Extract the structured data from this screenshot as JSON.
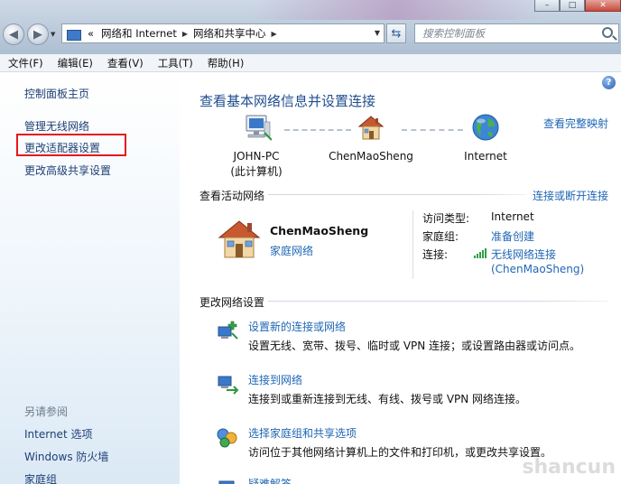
{
  "address": {
    "prefix": "«",
    "crumbs": [
      "网络和 Internet",
      "网络和共享中心"
    ]
  },
  "search": {
    "placeholder": "搜索控制面板"
  },
  "window_buttons": {
    "minimize": "–",
    "maximize": "□",
    "close": "✕"
  },
  "menu": [
    "文件(F)",
    "编辑(E)",
    "查看(V)",
    "工具(T)",
    "帮助(H)"
  ],
  "sidebar": {
    "home": "控制面板主页",
    "items": [
      "管理无线网络",
      "更改适配器设置",
      "更改高级共享设置"
    ],
    "highlighted_index": 1,
    "see_also_title": "另请参阅",
    "see_also": [
      "Internet 选项",
      "Windows 防火墙",
      "家庭组"
    ]
  },
  "main": {
    "heading": "查看基本网络信息并设置连接",
    "view_full_map": "查看完整映射",
    "map_nodes": [
      {
        "name": "JOHN-PC",
        "sub": "(此计算机)",
        "icon": "computer-icon"
      },
      {
        "name": "ChenMaoSheng",
        "sub": "",
        "icon": "home-network-icon"
      },
      {
        "name": "Internet",
        "sub": "",
        "icon": "globe-icon"
      }
    ],
    "active_networks_title": "查看活动网络",
    "connect_disconnect": "连接或断开连接",
    "active_network": {
      "name": "ChenMaoSheng",
      "type": "家庭网络",
      "access_type_label": "访问类型:",
      "access_type_value": "Internet",
      "homegroup_label": "家庭组:",
      "homegroup_value": "准备创建",
      "connection_label": "连接:",
      "connection_value": "无线网络连接",
      "connection_ssid": "(ChenMaoSheng)"
    },
    "change_settings_title": "更改网络设置",
    "tasks": [
      {
        "title": "设置新的连接或网络",
        "desc": "设置无线、宽带、拨号、临时或 VPN 连接；或设置路由器或访问点。",
        "icon": "new-connection-icon"
      },
      {
        "title": "连接到网络",
        "desc": "连接到或重新连接到无线、有线、拨号或 VPN 网络连接。",
        "icon": "connect-network-icon"
      },
      {
        "title": "选择家庭组和共享选项",
        "desc": "访问位于其他网络计算机上的文件和打印机，或更改共享设置。",
        "icon": "homegroup-icon"
      },
      {
        "title": "疑难解答",
        "desc": "",
        "icon": "troubleshoot-icon"
      }
    ]
  },
  "watermark": "shancun"
}
